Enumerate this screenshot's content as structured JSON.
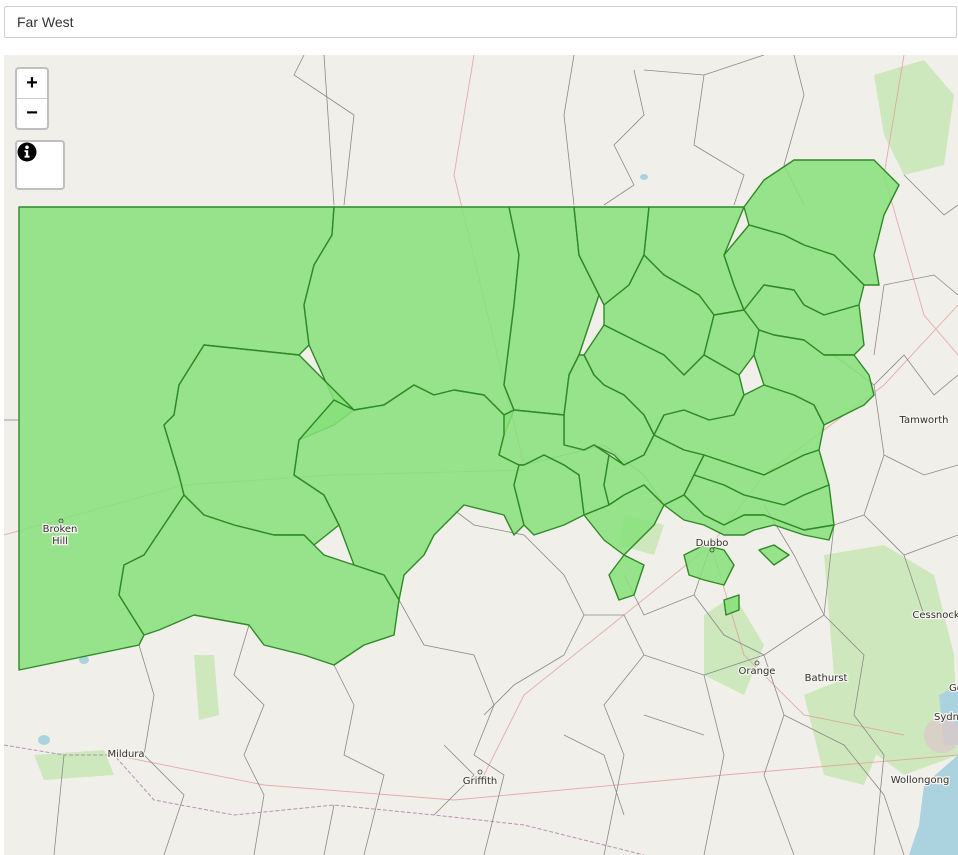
{
  "region_select": {
    "value": "Far West"
  },
  "map": {
    "zoom_in_label": "+",
    "zoom_out_label": "−",
    "info_icon": "info-circle-icon",
    "highlight_color": "#86e07a",
    "highlight_border": "#2f8a25",
    "places": {
      "broken_hill_1": "Broken",
      "broken_hill_2": "Hill",
      "mildura": "Mildura",
      "griffith": "Griffith",
      "dubbo": "Dubbo",
      "orange": "Orange",
      "bathurst": "Bathurst",
      "tamworth": "Tamworth",
      "cessnock": "Cessnock",
      "wollongong": "Wollongong",
      "sydney": "Sydn",
      "gosford": "Gos"
    }
  }
}
